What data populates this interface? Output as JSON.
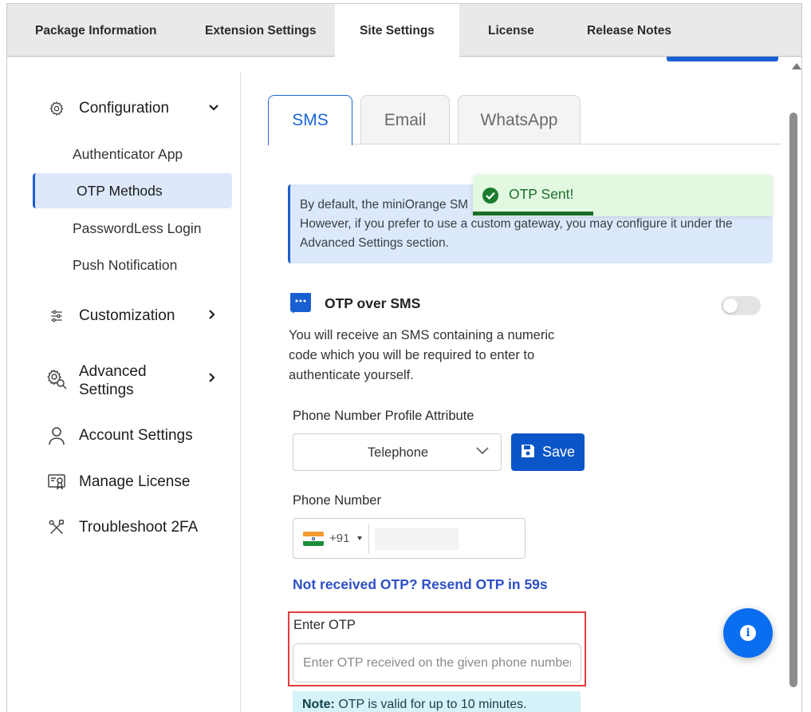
{
  "top_tabs": [
    {
      "label": "Package Information",
      "active": false
    },
    {
      "label": "Extension Settings",
      "active": false
    },
    {
      "label": "Site Settings",
      "active": true
    },
    {
      "label": "License",
      "active": false
    },
    {
      "label": "Release Notes",
      "active": false
    }
  ],
  "sidebar": {
    "configuration": {
      "label": "Configuration",
      "icon": "gear-icon",
      "expanded": true
    },
    "sub_items": [
      {
        "label": "Authenticator App",
        "active": false
      },
      {
        "label": "OTP Methods",
        "active": true
      },
      {
        "label": "PasswordLess Login",
        "active": false
      },
      {
        "label": "Push Notification",
        "active": false
      }
    ],
    "customization": {
      "label": "Customization",
      "icon": "sliders-icon"
    },
    "advanced": {
      "line1": "Advanced",
      "line2": "Settings",
      "icon": "gear-search-icon"
    },
    "account": {
      "label": "Account Settings",
      "icon": "user-icon"
    },
    "license": {
      "label": "Manage License",
      "icon": "certificate-icon"
    },
    "troubleshoot": {
      "label": "Troubleshoot 2FA",
      "icon": "tools-icon"
    }
  },
  "subtabs": [
    {
      "label": "SMS",
      "active": true
    },
    {
      "label": "Email",
      "active": false
    },
    {
      "label": "WhatsApp",
      "active": false
    }
  ],
  "info": {
    "line1": "By default, the miniOrange SM",
    "line2": "However, if you prefer to use a custom gateway, you may configure it under the",
    "line3": "Advanced Settings section."
  },
  "toast": {
    "message": "OTP Sent!",
    "icon": "check-circle-icon",
    "color": "#1b6e2a"
  },
  "section": {
    "title": "OTP over SMS",
    "icon": "chat-icon",
    "enabled": false,
    "description": "You will receive an SMS containing a numeric code which you will be required to enter to authenticate yourself."
  },
  "phone_attr": {
    "label": "Phone Number Profile Attribute",
    "selected": "Telephone"
  },
  "save_button": {
    "label": "Save",
    "icon": "save-icon"
  },
  "phone": {
    "label": "Phone Number",
    "country_code": "+91",
    "flag": "india-flag-icon"
  },
  "resend": {
    "text": "Not received OTP? Resend OTP in 59s"
  },
  "otp": {
    "label": "Enter OTP",
    "placeholder": "Enter OTP received on the given phone number"
  },
  "note": {
    "bold": "Note:",
    "text": " OTP is valid for up to 10 minutes."
  },
  "fab": {
    "icon": "info-icon",
    "glyph": "i"
  },
  "colors": {
    "accent": "#1a5fd1",
    "highlight_border": "#e23b3b",
    "success_bg": "#e3f8e1"
  }
}
